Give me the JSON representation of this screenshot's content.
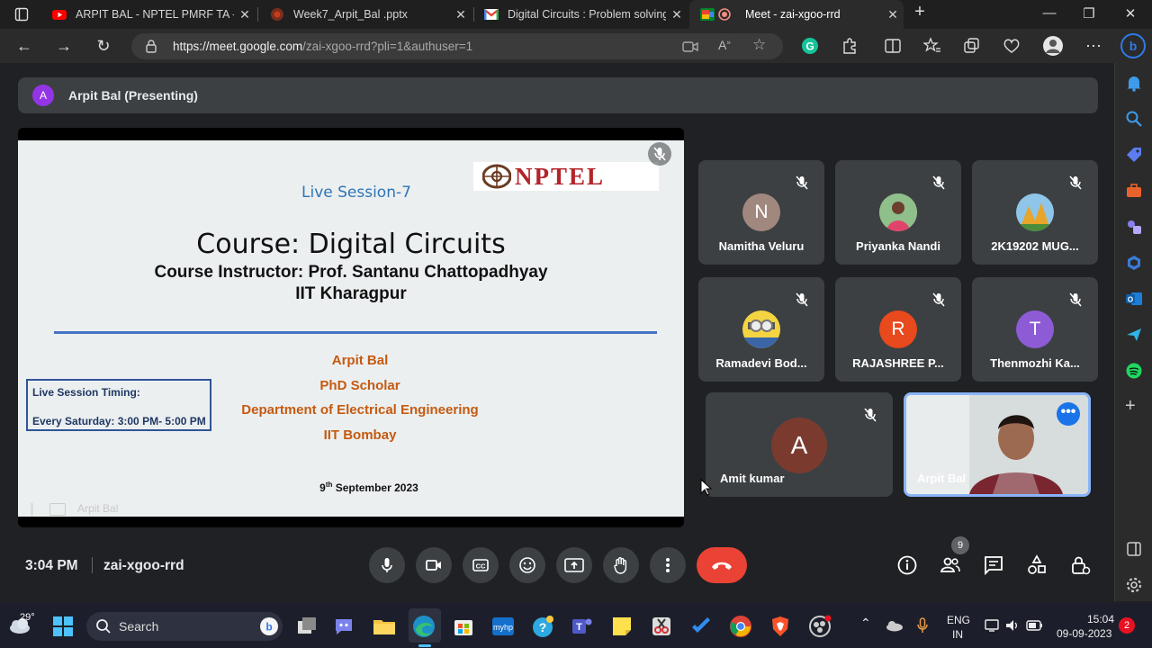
{
  "browser": {
    "tabs": [
      {
        "title": "ARPIT BAL - NPTEL PMRF TA - Yo",
        "icon": "youtube-icon",
        "color": "#ff0000",
        "active": false
      },
      {
        "title": "Week7_Arpit_Bal .pptx",
        "icon": "powerpoint-icon",
        "color": "#c43e1c",
        "active": false
      },
      {
        "title": "Digital Circuits : Problem solving",
        "icon": "gmail-icon",
        "color": "#ea4335",
        "active": false
      },
      {
        "title": "Meet - zai-xgoo-rrd",
        "icon": "meet-icon",
        "color": "#00ac47",
        "active": true
      }
    ],
    "url_host": "https://meet.google.com",
    "url_path": "/zai-xgoo-rrd?pli=1&authuser=1"
  },
  "meet": {
    "presenter_bar": {
      "initial": "A",
      "label": "Arpit Bal (Presenting)"
    },
    "slide": {
      "session": "Live Session-7",
      "course": "Course: Digital Circuits",
      "instructor": "Course Instructor: Prof. Santanu Chattopadhyay",
      "institute": "IIT Kharagpur",
      "presenter_name": "Arpit Bal",
      "presenter_role": "PhD Scholar",
      "presenter_dept": "Department of Electrical Engineering",
      "presenter_inst": "IIT Bombay",
      "timing_title": "Live Session Timing:",
      "timing_value": "Every Saturday: 3:00 PM- 5:00 PM",
      "date_day": "9",
      "date_sup": "th",
      "date_rest": " September 2023",
      "logo_text": "NPTEL",
      "footer_name": "Arpit Bal"
    },
    "participants": [
      {
        "name": "Namitha Veluru",
        "initial": "N",
        "color": "#a1887f",
        "muted": true
      },
      {
        "name": "Priyanka Nandi",
        "initial": "",
        "color": "#d6a98a",
        "muted": true
      },
      {
        "name": "2K19202 MUG...",
        "initial": "",
        "color": "#f2b233",
        "muted": true
      },
      {
        "name": "Ramadevi Bod...",
        "initial": "",
        "color": "#f5d442",
        "muted": true
      },
      {
        "name": "RAJASHREE P...",
        "initial": "R",
        "color": "#e8491d",
        "muted": true
      },
      {
        "name": "Thenmozhi Ka...",
        "initial": "T",
        "color": "#8e5bd6",
        "muted": true
      },
      {
        "name": "Amit kumar",
        "initial": "A",
        "color": "#7a3b2e",
        "muted": true
      }
    ],
    "self": {
      "name": "Arpit Bal"
    },
    "time": "3:04 PM",
    "code": "zai-xgoo-rrd",
    "people_count": "9"
  },
  "taskbar": {
    "weather": "29°",
    "search_label": "Search",
    "lang1": "ENG",
    "lang2": "IN",
    "time": "15:04",
    "date": "09-09-2023",
    "notif": "2"
  }
}
